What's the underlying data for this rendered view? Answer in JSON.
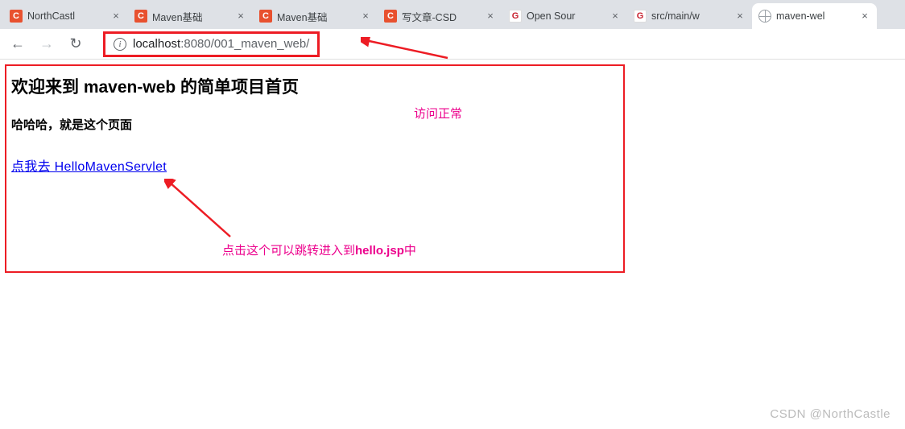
{
  "tabs": [
    {
      "title": "NorthCastl",
      "favicon": "c"
    },
    {
      "title": "Maven基础",
      "favicon": "c"
    },
    {
      "title": "Maven基础",
      "favicon": "c"
    },
    {
      "title": "写文章-CSD",
      "favicon": "c"
    },
    {
      "title": "Open Sour",
      "favicon": "g"
    },
    {
      "title": "src/main/w",
      "favicon": "g"
    },
    {
      "title": "maven-wel",
      "favicon": "globe",
      "active": true
    }
  ],
  "url": {
    "host": "localhost",
    "port": ":8080",
    "path": "/001_maven_web/"
  },
  "page": {
    "heading": "欢迎来到 maven-web 的简单项目首页",
    "subheading": "哈哈哈，就是这个页面",
    "link_text": "点我去 HelloMavenServlet"
  },
  "annotations": {
    "a1": "访问正常",
    "a2_pre": "点击这个可以跳转进入到",
    "a2_bold": "hello.jsp",
    "a2_post": "中"
  },
  "watermark": "CSDN @NorthCastle",
  "glyphs": {
    "close": "×",
    "back": "←",
    "forward": "→",
    "reload": "↻",
    "info": "i",
    "c": "C",
    "g": "G"
  }
}
